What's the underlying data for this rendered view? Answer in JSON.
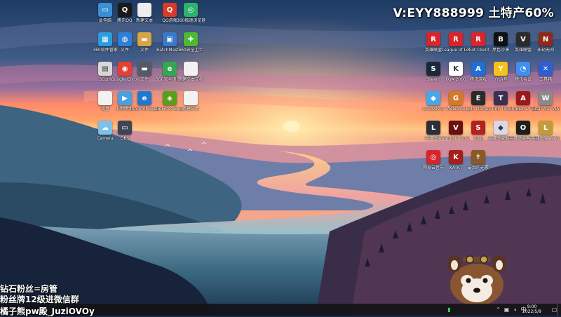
{
  "overlay": {
    "watermark": "V:EYY888999 土特产60%",
    "line1": "钻石粉丝=房管",
    "line2": "粉丝牌12级进微信群",
    "streamer": "橘子熊pw殿_JuziOVOy"
  },
  "desktop": {
    "icons": [
      {
        "label": "此电脑",
        "icon": "computer-icon",
        "color": "#3b8fd6",
        "char": "▭"
      },
      {
        "label": "腾讯QQ",
        "icon": "qq-icon",
        "color": "#1a1a1a",
        "char": "Q"
      },
      {
        "label": "新建文本",
        "icon": "text-file-icon",
        "color": "#eeeeee",
        "char": ""
      },
      {
        "label": "QQ游戏",
        "icon": "qq-game-icon",
        "color": "#d93b2b",
        "char": "Q"
      },
      {
        "label": "360极速浏览器",
        "icon": "browser-360-icon",
        "color": "#2db36b",
        "char": "◎"
      },
      {
        "label": "360软件管家",
        "icon": "software-manager-icon",
        "color": "#2a9de0",
        "char": "▦"
      },
      {
        "label": "文件",
        "icon": "globe-icon",
        "color": "#2f7fd8",
        "char": "◍"
      },
      {
        "label": "文件",
        "icon": "folder-icon",
        "color": "#d8a544",
        "char": "▬"
      },
      {
        "label": "BatchMaster",
        "icon": "batch-icon",
        "color": "#3a78c8",
        "char": "▣"
      },
      {
        "label": "360安全卫士",
        "icon": "security-360-icon",
        "color": "#4fb833",
        "char": "✚"
      },
      {
        "label": "3Com",
        "icon": "recycle-icon",
        "color": "#d8d8d8",
        "char": "▤"
      },
      {
        "label": "Google Chrome",
        "icon": "chrome-icon",
        "color": "#e34133",
        "char": "◉"
      },
      {
        "label": "文件",
        "icon": "drive-icon",
        "color": "#555b66",
        "char": "▬"
      },
      {
        "label": "360安全浏览器",
        "icon": "browser-ie-icon",
        "color": "#32a852",
        "char": "e"
      },
      {
        "label": "新建文本文档",
        "icon": "document-icon",
        "color": "#f2f2f2",
        "char": ""
      },
      {
        "label": "增量",
        "icon": "blank-file-icon",
        "color": "#f2f2f2",
        "char": ""
      },
      {
        "label": "视频素材",
        "icon": "video-file-icon",
        "color": "#4aa0e0",
        "char": "▶"
      },
      {
        "label": "Internet Explorer",
        "icon": "ie-icon",
        "color": "#1f79d1",
        "char": "e"
      },
      {
        "label": "GeForce Experience",
        "icon": "nvidia-icon",
        "color": "#5a9e1a",
        "char": "◈"
      },
      {
        "label": "新建文本",
        "icon": "note-file-icon",
        "color": "#f2f2f2",
        "char": ""
      },
      {
        "label": "Camera",
        "icon": "cloud-icon",
        "color": "#7fc0ea",
        "char": "☁"
      },
      {
        "label": "OBS",
        "icon": "monitor-icon",
        "color": "#3c4654",
        "char": "▭"
      },
      {
        "label": "英雄联盟",
        "icon": "riot-icon",
        "color": "#d6262c",
        "char": "R"
      },
      {
        "label": "League of Legends",
        "icon": "riot-lol-icon",
        "color": "#d6262c",
        "char": "R"
      },
      {
        "label": "Riot Client",
        "icon": "riot-client-icon",
        "color": "#d6262c",
        "char": "R"
      },
      {
        "label": "黑色沙漠",
        "icon": "black-desert-icon",
        "color": "#111111",
        "char": "B"
      },
      {
        "label": "英雄联盟",
        "icon": "valorant-icon",
        "color": "#2b2b2b",
        "char": "V"
      },
      {
        "label": "永劫无间",
        "icon": "naraka-icon",
        "color": "#8e2a1c",
        "char": "N"
      },
      {
        "label": "Steam",
        "icon": "steam-icon",
        "color": "#1b2838",
        "char": "S"
      },
      {
        "label": "KOA 2000",
        "icon": "koa-icon",
        "color": "#ffffff",
        "char": "K"
      },
      {
        "label": "腾讯游戏",
        "icon": "tencent-game-icon",
        "color": "#1f6fd6",
        "char": "A"
      },
      {
        "label": "YY语音",
        "icon": "yy-icon",
        "color": "#f4c21b",
        "char": "Y"
      },
      {
        "label": "腾讯会议",
        "icon": "meeting-icon",
        "color": "#3f8ef2",
        "char": "◔"
      },
      {
        "label": "工具箱",
        "icon": "toolbox-icon",
        "color": "#2d5fd1",
        "char": "✕"
      },
      {
        "label": "CrossOver",
        "icon": "crossover-icon",
        "color": "#48a7e6",
        "char": "◆"
      },
      {
        "label": "WeGame",
        "icon": "wegame-icon",
        "color": "#d27a28",
        "char": "G"
      },
      {
        "label": "Epic Games",
        "icon": "epic-icon",
        "color": "#2a2a2a",
        "char": "E"
      },
      {
        "label": "Tiny Tina",
        "icon": "tina-icon",
        "color": "#3c2f52",
        "char": "T"
      },
      {
        "label": "Shogun 2 Total War",
        "icon": "shogun-icon",
        "color": "#9a1919",
        "char": "A"
      },
      {
        "label": "Total War WARHAMMER",
        "icon": "warhammer-icon",
        "color": "#8a8a8a",
        "char": "W"
      },
      {
        "label": "英雄联盟",
        "icon": "lol-icon",
        "color": "#2a2f3a",
        "char": "L"
      },
      {
        "label": "Vampire Survivors",
        "icon": "vampire-icon",
        "color": "#6b1010",
        "char": "V"
      },
      {
        "label": "Ship",
        "icon": "ship-icon",
        "color": "#b32222",
        "char": "S"
      },
      {
        "label": "英雄联盟助手",
        "icon": "helper-icon",
        "color": "#d8d8e8",
        "char": "◆"
      },
      {
        "label": "英雄联盟客户端",
        "icon": "overwolf-icon",
        "color": "#1e1e1e",
        "char": "O"
      },
      {
        "label": "英雄联盟 WeGame版",
        "icon": "lol-wegame-icon",
        "color": "#c39b3c",
        "char": "L"
      },
      {
        "label": "网易云音乐",
        "icon": "netease-music-icon",
        "color": "#d6262c",
        "char": "◎"
      },
      {
        "label": "KA_KT",
        "icon": "kakt-icon",
        "color": "#a52018",
        "char": "K"
      },
      {
        "label": "最后的元素",
        "icon": "sword-icon",
        "color": "#8a5a22",
        "char": "✝"
      }
    ]
  },
  "taskbar": {
    "clock_time": "9:00",
    "clock_date": "2022/5/9"
  }
}
